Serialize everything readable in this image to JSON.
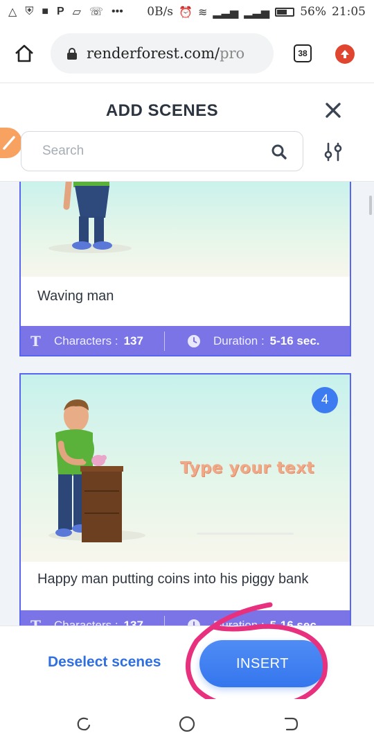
{
  "status_bar": {
    "network_speed": "0B/s",
    "battery_percent": "56%",
    "time": "21:05"
  },
  "browser": {
    "url_main": "renderforest.com/",
    "url_path": "pro",
    "tab_count": "38"
  },
  "modal": {
    "title": "ADD SCENES",
    "search_placeholder": "Search"
  },
  "scenes": [
    {
      "title": "Waving man",
      "characters_label": "Characters :",
      "characters_value": "137",
      "duration_label": "Duration :",
      "duration_value": "5-16 sec.",
      "selected": true
    },
    {
      "badge": "4",
      "overlay_text": "Type your text",
      "title": "Happy man putting coins into his piggy bank",
      "characters_label": "Characters :",
      "characters_value": "137",
      "duration_label": "Duration :",
      "duration_value": "5-16 sec.",
      "selected": true
    }
  ],
  "footer": {
    "deselect_label": "Deselect scenes",
    "insert_label": "INSERT"
  },
  "colors": {
    "accent_blue": "#3576ee",
    "card_border": "#5865f2",
    "meta_bar": "#7b74e6",
    "annotation_pink": "#e8317e",
    "upload_red": "#e0462f"
  }
}
